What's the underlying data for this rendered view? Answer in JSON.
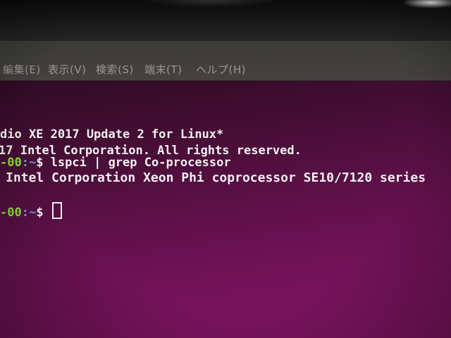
{
  "menubar": {
    "items": [
      "編集(E)",
      "表示(V)",
      "検索(S)",
      "端末(T)",
      "ヘルプ(H)"
    ]
  },
  "terminal": {
    "line1": "dio XE 2017 Update 2 for Linux*",
    "line2": "17 Intel Corporation. All rights reserved.",
    "line3": {
      "prompt_host": "-00",
      "prompt_path": ":~",
      "prompt_symbol": "$ ",
      "command": "lspci | grep Co-processor"
    },
    "line4": "Intel Corporation Xeon Phi coprocessor SE10/7120 series",
    "line5": {
      "prompt_host": "-00",
      "prompt_path": ":~",
      "prompt_symbol": "$ "
    }
  },
  "colors": {
    "prompt_host": "#8ae234",
    "prompt_path": "#729fcf",
    "terminal_bg": "#6a1152",
    "text": "#f4f0f2"
  }
}
